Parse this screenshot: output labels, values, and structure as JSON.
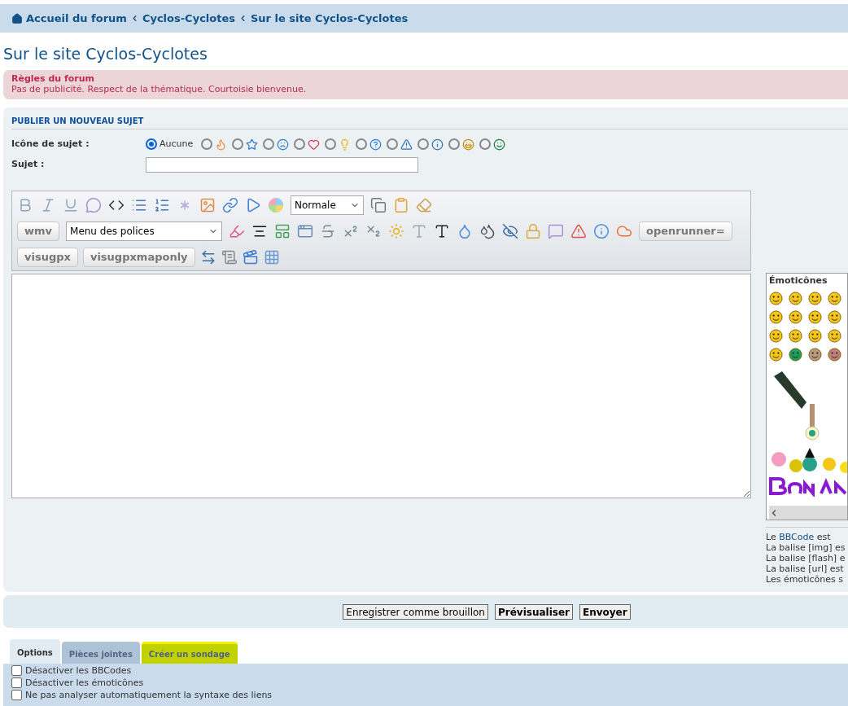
{
  "breadcrumbs": [
    "Accueil du forum",
    "Cyclos-Cyclotes",
    "Sur le site Cyclos-Cyclotes"
  ],
  "page_title": "Sur le site Cyclos-Cyclotes",
  "rules": {
    "title": "Règles du forum",
    "text": "Pas de publicité. Respect de la thématique. Courtoisie bienvenue."
  },
  "form": {
    "heading": "PUBLIER UN NOUVEAU SUJET",
    "topic_icon": {
      "label": "Icône de sujet :",
      "options": [
        {
          "label": "Aucune",
          "selected": true
        },
        {
          "selected": false
        },
        {
          "selected": false
        },
        {
          "selected": false
        },
        {
          "selected": false
        },
        {
          "selected": false
        },
        {
          "selected": false
        },
        {
          "selected": false
        },
        {
          "selected": false
        },
        {
          "selected": false
        },
        {
          "selected": false
        }
      ]
    },
    "subject": {
      "label": "Sujet :"
    },
    "toolbar": {
      "size_select": "Normale",
      "font_select": "Menu des polices",
      "row2_start_button": "wmv",
      "row2_end_button": "openrunner=",
      "row3_buttons": [
        "visugpx",
        "visugpxmaponly"
      ]
    },
    "smilies": {
      "title": "Émoticônes"
    },
    "notes": [
      "Le **BBCode** est",
      "La balise [img] es",
      "La balise [flash] e",
      "La balise [url] est",
      "Les émoticônes s"
    ]
  },
  "actions": [
    {
      "label": "Enregistrer comme brouillon",
      "bold": false
    },
    {
      "label": "Prévisualiser",
      "bold": true
    },
    {
      "label": "Envoyer",
      "bold": true
    }
  ],
  "tabs": [
    {
      "label": "Options",
      "selected": true,
      "highlighted": false
    },
    {
      "label": "Pièces jointes",
      "selected": false,
      "highlighted": false
    },
    {
      "label": "Créer un sondage",
      "selected": false,
      "highlighted": true
    }
  ],
  "options": [
    {
      "label": "Désactiver les BBCodes",
      "checked": false
    },
    {
      "label": "Désactiver les émoticônes",
      "checked": false
    },
    {
      "label": "Ne pas analyser automatiquement la syntaxe des liens",
      "checked": false
    }
  ]
}
